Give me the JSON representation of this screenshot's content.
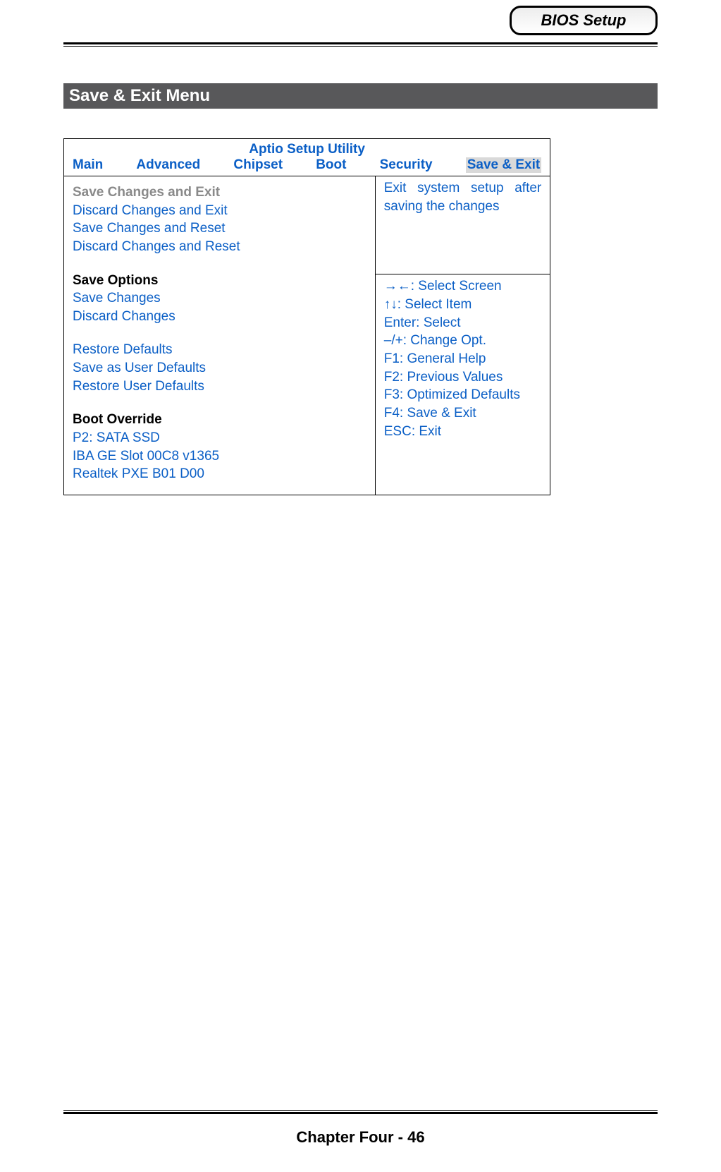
{
  "header": {
    "label": "BIOS Setup"
  },
  "section_title": "Save & Exit Menu",
  "bios": {
    "title": "Aptio Setup Utility",
    "tabs": {
      "main": "Main",
      "advanced": "Advanced",
      "chipset": "Chipset",
      "boot": "Boot",
      "security": "Security",
      "save_exit": "Save & Exit"
    },
    "left": {
      "save_changes_exit": "Save Changes and Exit",
      "discard_changes_exit": "Discard Changes and Exit",
      "save_changes_reset": "Save Changes and Reset",
      "discard_changes_reset": "Discard Changes and Reset",
      "save_options_heading": "Save Options",
      "save_changes": "Save Changes",
      "discard_changes": "Discard Changes",
      "restore_defaults": "Restore Defaults",
      "save_user_defaults": "Save as User Defaults",
      "restore_user_defaults": "Restore User Defaults",
      "boot_override_heading": "Boot Override",
      "boot1": "P2: SATA SSD",
      "boot2": "IBA GE Slot 00C8 v1365",
      "boot3": "Realtek PXE B01 D00"
    },
    "help_text": "Exit system setup after saving the changes",
    "hints": {
      "h1": "→←: Select Screen",
      "h2": "↑↓: Select Item",
      "h3": "Enter: Select",
      "h4": "–/+: Change Opt.",
      "h5": "F1: General Help",
      "h6": "F2: Previous Values",
      "h7": "F3: Optimized Defaults",
      "h8": "F4: Save & Exit",
      "h9": "ESC: Exit"
    }
  },
  "footer": "Chapter Four - 46"
}
